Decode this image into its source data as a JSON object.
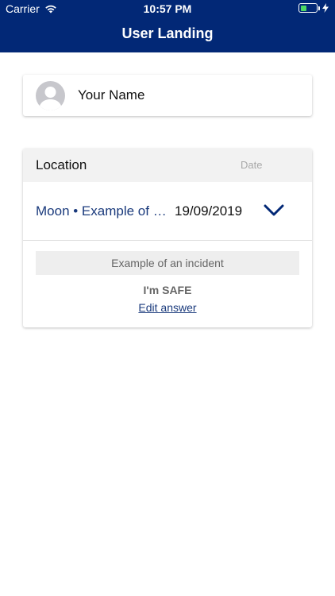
{
  "status_bar": {
    "carrier": "Carrier",
    "time": "10:57 PM",
    "battery_level": 0.4
  },
  "nav": {
    "title": "User Landing"
  },
  "profile": {
    "name": "Your Name",
    "avatar_icon": "user-avatar-placeholder"
  },
  "incidents": {
    "header": {
      "location_label": "Location",
      "date_label": "Date"
    },
    "item": {
      "title": "Moon • Example of an incident",
      "date": "19/09/2019",
      "expand_icon": "chevron-down-icon",
      "name": "Example of an incident",
      "answer": "I'm SAFE",
      "edit_label": "Edit answer"
    }
  },
  "colors": {
    "brand": "#022876",
    "link": "#1a3a7c",
    "battery": "#4cd964"
  }
}
